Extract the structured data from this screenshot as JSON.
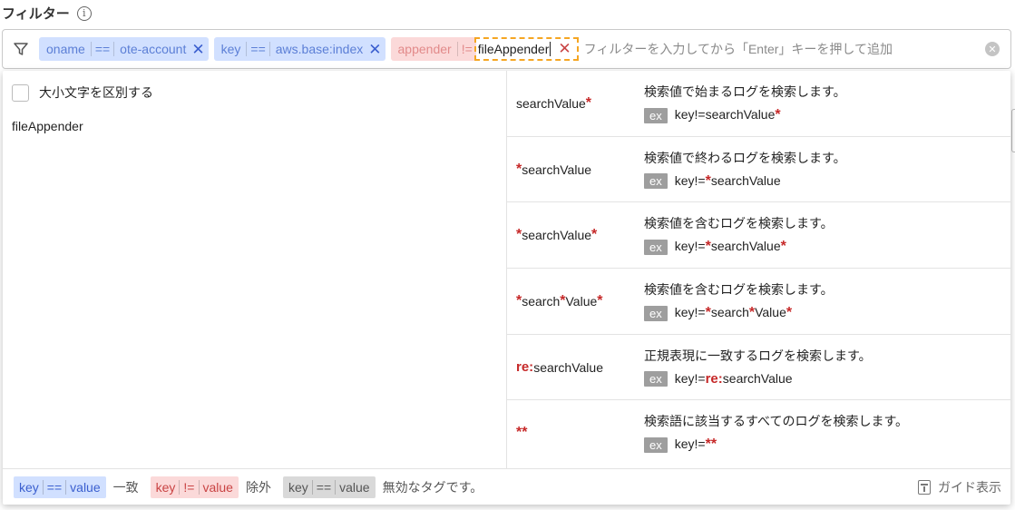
{
  "header": {
    "title": "フィルター",
    "info_icon": "info-icon"
  },
  "filter_bar": {
    "chips": [
      {
        "key": "oname",
        "op": "==",
        "value": "ote-account",
        "kind": "include"
      },
      {
        "key": "key",
        "op": "==",
        "value": "aws.base:index",
        "kind": "include"
      },
      {
        "key": "appender",
        "op": "!=",
        "value": "fileAppender",
        "kind": "exclude",
        "editing": true
      }
    ],
    "placeholder": "フィルターを入力してから「Enter」キーを押して追加"
  },
  "options": {
    "case_sensitive_label": "大小文字を区別する",
    "case_sensitive_checked": false
  },
  "suggestions": [
    "fileAppender"
  ],
  "help": {
    "ex_label": "ex",
    "rows": [
      {
        "pattern": [
          "searchValue",
          "*"
        ],
        "desc": "検索値で始まるログを検索します。",
        "example": [
          "key!=searchValue",
          "*"
        ]
      },
      {
        "pattern": [
          "*",
          "searchValue"
        ],
        "desc": "検索値で終わるログを検索します。",
        "example": [
          "key!=",
          "*",
          "searchValue"
        ]
      },
      {
        "pattern": [
          "*",
          "searchValue",
          "*"
        ],
        "desc": "検索値を含むログを検索します。",
        "example": [
          "key!=",
          "*",
          "searchValue",
          "*"
        ]
      },
      {
        "pattern": [
          "*",
          "search",
          "*",
          "Value",
          "*"
        ],
        "desc": "検索値を含むログを検索します。",
        "example": [
          "key!=",
          "*",
          "search",
          "*",
          "Value",
          "*"
        ]
      },
      {
        "pattern": [
          "re:",
          "searchValue"
        ],
        "desc": "正規表現に一致するログを検索します。",
        "example": [
          "key!=",
          "re:",
          "searchValue"
        ]
      },
      {
        "pattern": [
          "**"
        ],
        "desc": "検索語に該当するすべてのログを検索します。",
        "example": [
          "key!=",
          "**"
        ]
      }
    ]
  },
  "footer": {
    "legend": [
      {
        "key": "key",
        "op": "==",
        "value": "value",
        "kind": "include",
        "text": "一致"
      },
      {
        "key": "key",
        "op": "!=",
        "value": "value",
        "kind": "exclude",
        "text": "除外"
      },
      {
        "key": "key",
        "op": "==",
        "value": "value",
        "kind": "disabled",
        "text": "無効なタグです。"
      }
    ],
    "guide_label": "ガイド表示"
  },
  "colors": {
    "include_bg": "#d1e0ff",
    "exclude_bg": "#fbd9d9",
    "disabled_bg": "#d9d9d9",
    "accent_red": "#c62828",
    "edit_outline": "#f5a623"
  }
}
